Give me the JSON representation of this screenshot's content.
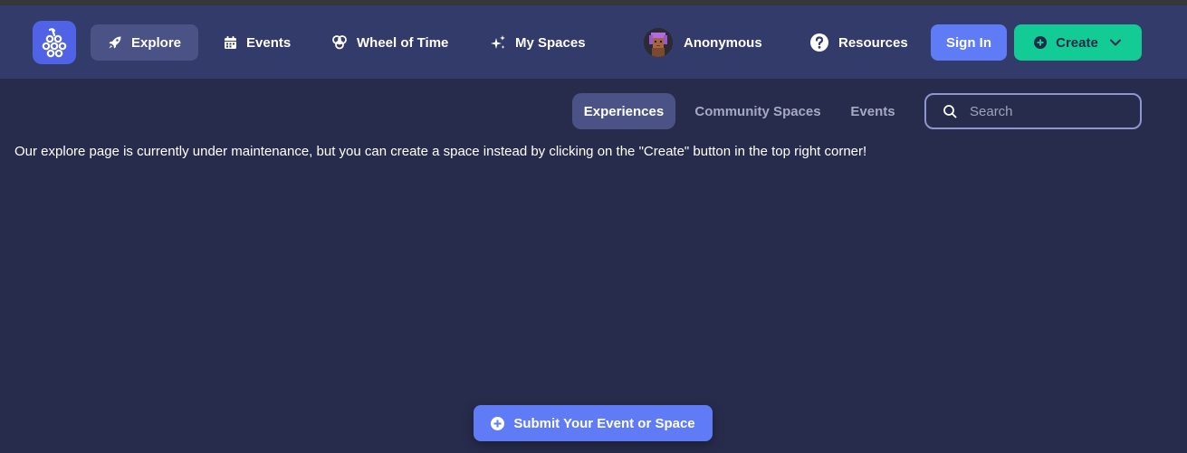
{
  "nav": {
    "logo_icon": "grapes-logo-icon",
    "items": [
      {
        "label": "Explore",
        "icon": "rocket-icon",
        "active": true
      },
      {
        "label": "Events",
        "icon": "calendar-icon"
      },
      {
        "label": "Wheel of Time",
        "icon": "wheel-of-time-icon"
      },
      {
        "label": "My Spaces",
        "icon": "sparkles-icon"
      },
      {
        "label": "Anonymous",
        "icon": "avatar"
      },
      {
        "label": "Resources",
        "icon": "question-circle-icon"
      }
    ],
    "signin_label": "Sign In",
    "create_label": "Create"
  },
  "subnav": {
    "tabs": [
      {
        "label": "Experiences",
        "active": true
      },
      {
        "label": "Community Spaces"
      },
      {
        "label": "Events"
      }
    ],
    "search_placeholder": "Search"
  },
  "main": {
    "notice": "Our explore page is currently under maintenance, but you can create a space instead by clicking on the \"Create\" button in the top right corner!"
  },
  "footer": {
    "submit_label": "Submit Your Event or Space"
  },
  "colors": {
    "background": "#282c4c",
    "navbar": "#333b6a",
    "active_tab": "#4b5386",
    "primary_button": "#5f7cf6",
    "create_button": "#13cc95",
    "logo": "#5063e6"
  }
}
